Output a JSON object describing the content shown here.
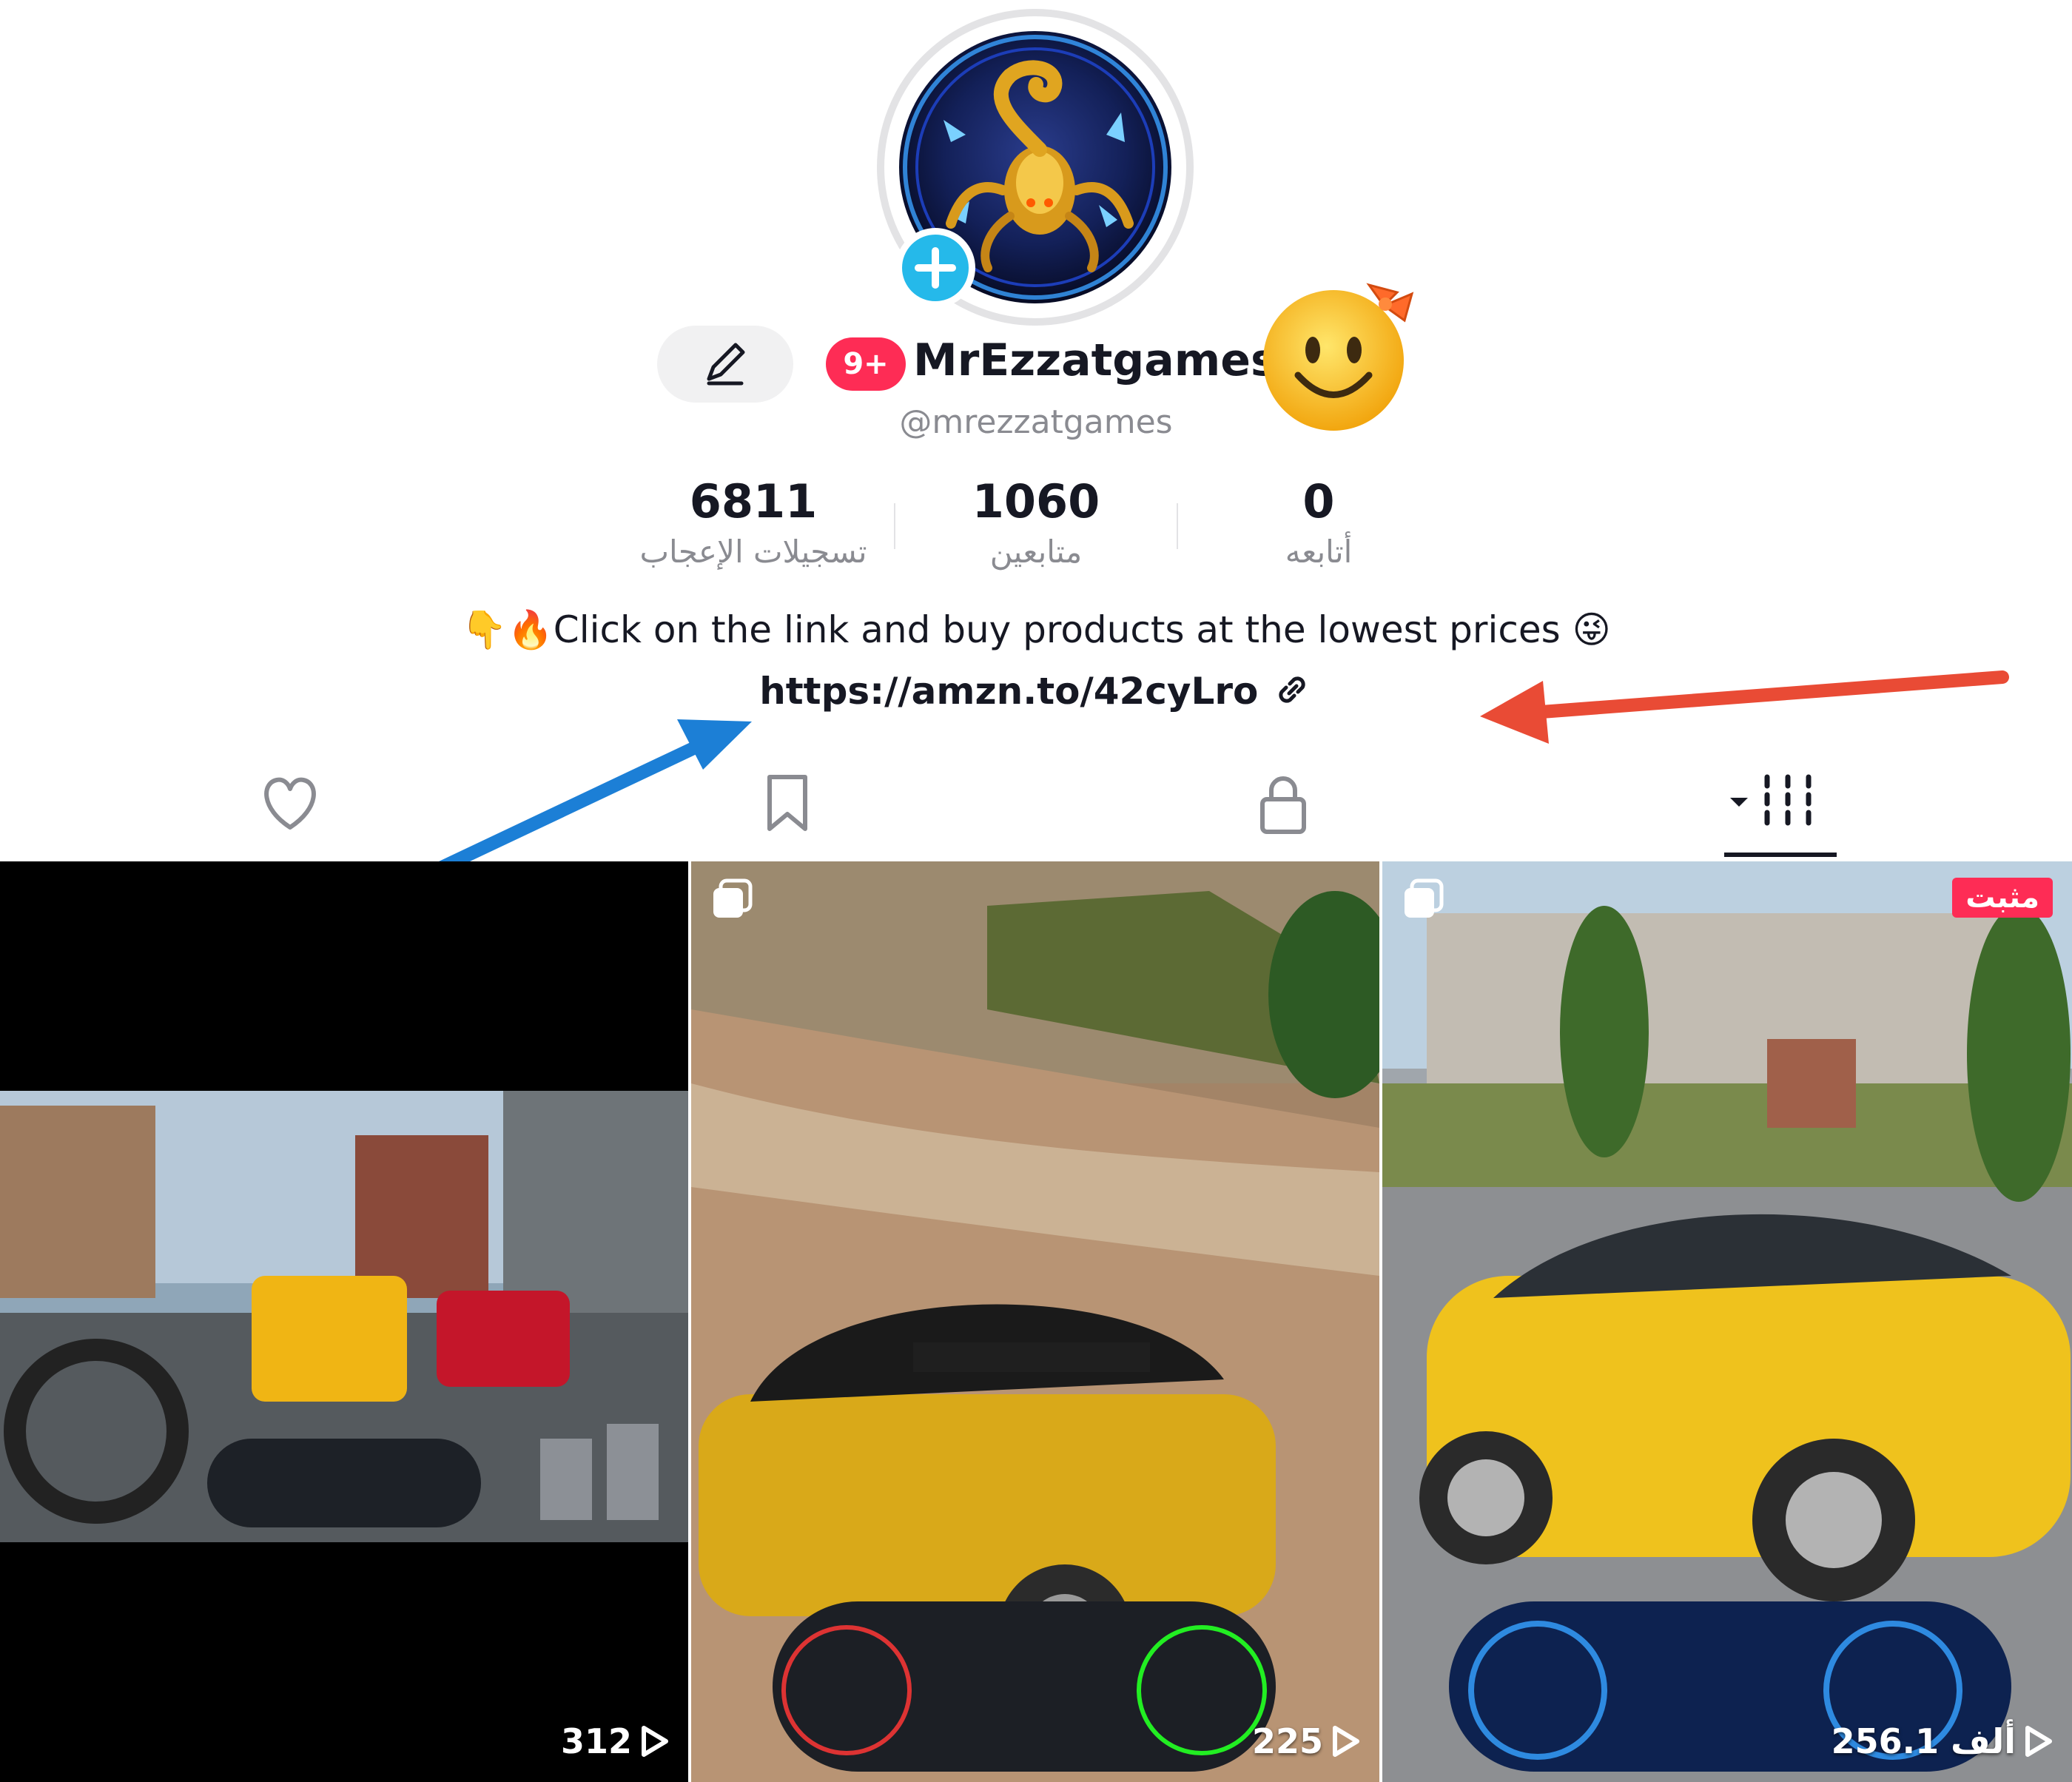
{
  "profile": {
    "display_name": "MrEzzatgames",
    "username": "@mrezzatgames",
    "notification_badge": "9+",
    "avatar_icon": "scorpion-logo",
    "emoji_icon": "smiley-with-bow"
  },
  "stats": [
    {
      "value": "6811",
      "label": "تسجيلات الإعجاب"
    },
    {
      "value": "1060",
      "label": "متابعين"
    },
    {
      "value": "0",
      "label": "أتابعه"
    }
  ],
  "bio": {
    "text": "Click on the link and buy products at the lowest prices",
    "leading_emojis": "👇🔥",
    "trailing_emoji": "😜",
    "link": "https://amzn.to/42cyLro"
  },
  "tabs": [
    {
      "icon": "heart-icon"
    },
    {
      "icon": "bookmark-icon"
    },
    {
      "icon": "lock-icon"
    },
    {
      "icon": "videos-grid-icon",
      "active": true
    }
  ],
  "videos": [
    {
      "views": "312",
      "pinned": false,
      "multi": false
    },
    {
      "views": "225",
      "pinned": false,
      "multi": true
    },
    {
      "views": "256.1 ألف",
      "pinned": true,
      "pinned_label": "مثبت",
      "multi": true
    }
  ],
  "annotations": {
    "red_arrow_color": "#e94b35",
    "blue_arrow_color": "#1c7fd6"
  }
}
